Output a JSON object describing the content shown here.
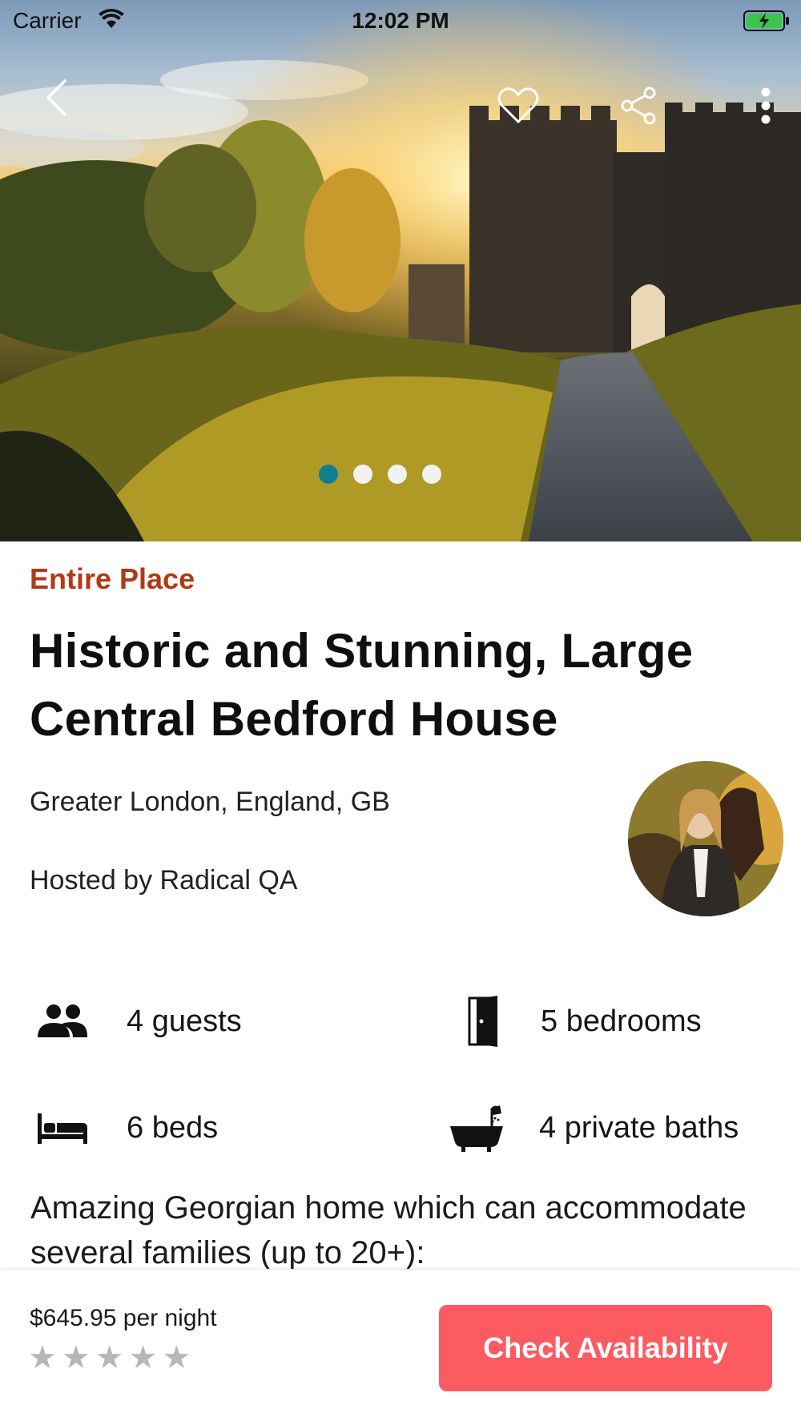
{
  "status_bar": {
    "carrier": "Carrier",
    "time": "12:02 PM"
  },
  "hero": {
    "pager_total": 4,
    "pager_active_index": 0,
    "accent_color": "#0f7f92"
  },
  "listing": {
    "type": "Entire Place",
    "title": "Historic and Stunning, Large Central Bedford House",
    "location": "Greater London, England, GB",
    "host": "Hosted by Radical QA",
    "description": "Amazing Georgian home which can accommodate several families (up to 20+):"
  },
  "amenities": {
    "guests": "4 guests",
    "bedrooms": "5 bedrooms",
    "beds": "6 beds",
    "baths": "4 private baths"
  },
  "booking": {
    "price": "$645.95 per night",
    "rating": 0,
    "rating_max": 5,
    "cta_label": "Check Availability",
    "cta_color": "#fc5b61"
  },
  "colors": {
    "type_label": "#b13a14"
  }
}
